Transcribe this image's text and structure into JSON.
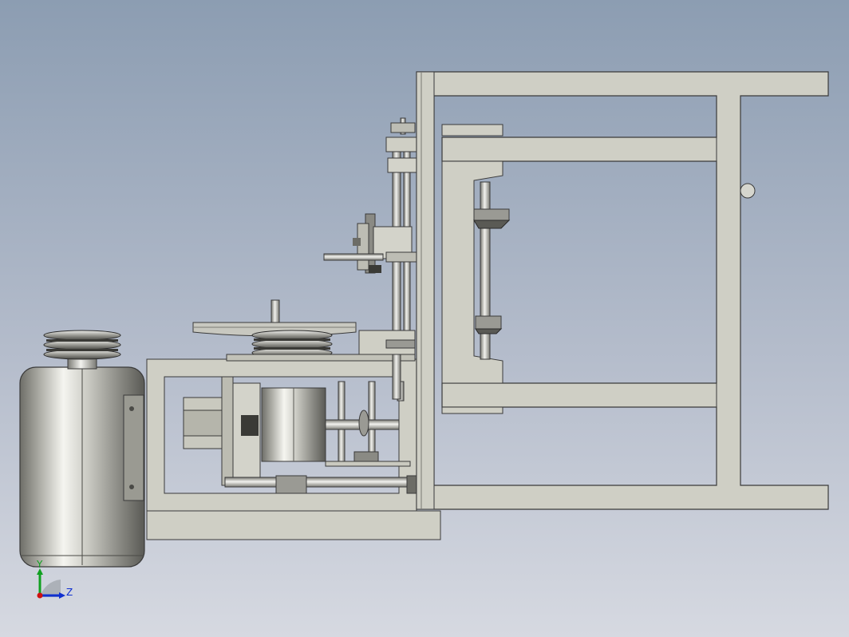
{
  "triad": {
    "y_label": "Y",
    "z_label": "Z",
    "colors": {
      "y": "#10a020",
      "z": "#1030d0",
      "x": "#d01010"
    }
  },
  "palette": {
    "frame_fill": "#cfcfc5",
    "frame_stroke": "#3a3a3a",
    "metal_light": "#eeeeea",
    "metal_mid": "#b8b8b2",
    "metal_dark": "#6c6c66"
  },
  "components": [
    "electric-motor",
    "motor-pulley",
    "large-flywheel",
    "gear-housing",
    "vertical-shaft-assembly",
    "main-frame",
    "bevel-gear-shaft"
  ]
}
